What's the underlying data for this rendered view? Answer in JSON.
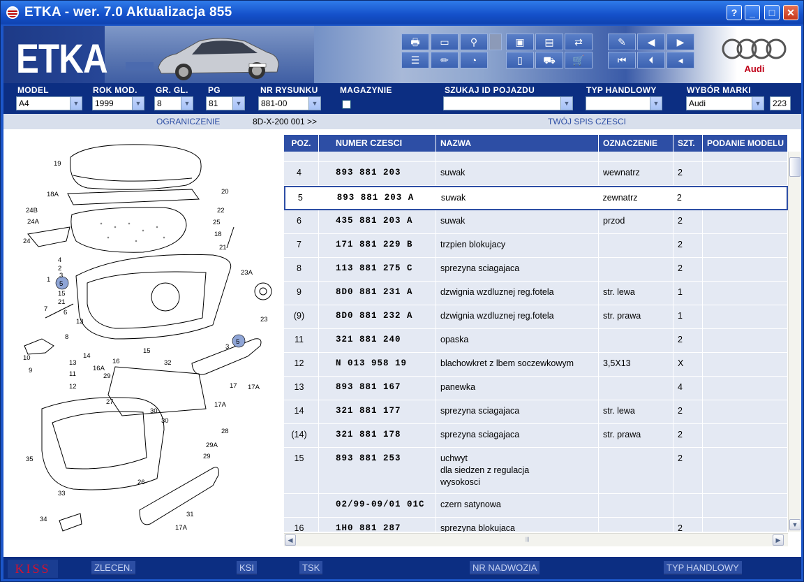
{
  "window": {
    "title": "ETKA - wer. 7.0 Aktualizacja 855",
    "buttons": [
      "?",
      "_",
      "□",
      "✕"
    ]
  },
  "header": {
    "logo": "ETKA",
    "brand": "Audi"
  },
  "filters": {
    "model": {
      "label": "MODEL",
      "value": "A4"
    },
    "rok_mod": {
      "label": "ROK MOD.",
      "value": "1999"
    },
    "gr_gl": {
      "label": "GR. GL.",
      "value": "8"
    },
    "pg": {
      "label": "PG",
      "value": "81"
    },
    "nr_rysunku": {
      "label": "NR RYSUNKU",
      "value": "881-00"
    },
    "magazynie": {
      "label": "MAGAZYNIE"
    },
    "szukaj": {
      "label": "SZUKAJ ID POJAZDU",
      "value": ""
    },
    "typ": {
      "label": "TYP HANDLOWY",
      "value": ""
    },
    "marka": {
      "label": "WYBÓR MARKI",
      "value": "Audi"
    },
    "count": "223"
  },
  "infobar": {
    "ograniczenie": "OGRANICZENIE",
    "range": "8D-X-200 001 >>",
    "spis": "TWÓJ SPIS CZESCI"
  },
  "table": {
    "headers": [
      "POZ.",
      "NUMER CZESCI",
      "NAZWA",
      "OZNACZENIE",
      "SZT.",
      "PODANIE MODELU"
    ],
    "rows": [
      {
        "poz": "",
        "nr": "",
        "nazwa": "",
        "ozn": "",
        "szt": ""
      },
      {
        "poz": "4",
        "nr": "893 881 203",
        "nazwa": "suwak",
        "ozn": "wewnatrz",
        "szt": "2"
      },
      {
        "poz": "5",
        "nr": "893 881 203 A",
        "nazwa": "suwak",
        "ozn": "zewnatrz",
        "szt": "2"
      },
      {
        "poz": "6",
        "nr": "435 881 203 A",
        "nazwa": "suwak",
        "ozn": "przod",
        "szt": "2"
      },
      {
        "poz": "7",
        "nr": "171 881 229 B",
        "nazwa": "trzpien blokujacy",
        "ozn": "",
        "szt": "2"
      },
      {
        "poz": "8",
        "nr": "113 881 275 C",
        "nazwa": "sprezyna sciagajaca",
        "ozn": "",
        "szt": "2"
      },
      {
        "poz": "9",
        "nr": "8D0 881 231 A",
        "nazwa": "dzwignia wzdluznej reg.fotela",
        "ozn": "str. lewa",
        "szt": "1"
      },
      {
        "poz": "(9)",
        "nr": "8D0 881 232 A",
        "nazwa": "dzwignia wzdluznej reg.fotela",
        "ozn": "str. prawa",
        "szt": "1"
      },
      {
        "poz": "11",
        "nr": "321 881 240",
        "nazwa": "opaska",
        "ozn": "",
        "szt": "2"
      },
      {
        "poz": "12",
        "nr": "N   013 958 19",
        "nazwa": "blachowkret z lbem soczewkowym",
        "ozn": "3,5X13",
        "szt": "X"
      },
      {
        "poz": "13",
        "nr": "893 881 167",
        "nazwa": "panewka",
        "ozn": "",
        "szt": "4"
      },
      {
        "poz": "14",
        "nr": "321 881 177",
        "nazwa": "sprezyna sciagajaca",
        "ozn": "str. lewa",
        "szt": "2"
      },
      {
        "poz": "(14)",
        "nr": "321 881 178",
        "nazwa": "sprezyna sciagajaca",
        "ozn": "str. prawa",
        "szt": "2"
      },
      {
        "poz": "15",
        "nr": "893 881 253",
        "nazwa": "uchwyt\ndla siedzen z regulacja\nwysokosci",
        "ozn": "",
        "szt": "2"
      },
      {
        "poz": "",
        "nr": "02/99-09/01 01C",
        "nazwa": "czern satynowa",
        "ozn": "",
        "szt": ""
      },
      {
        "poz": "16",
        "nr": "1H0 881 287",
        "nazwa": "sprezyna blokujaca",
        "ozn": "",
        "szt": "2"
      }
    ]
  },
  "diagram_labels": [
    "19",
    "20",
    "18A",
    "22",
    "24B",
    "25",
    "24A",
    "18",
    "24",
    "21",
    "4",
    "2",
    "1",
    "5",
    "15",
    "21",
    "23A",
    "3",
    "7",
    "6",
    "13",
    "8",
    "10",
    "9",
    "14",
    "13",
    "16A",
    "16",
    "11",
    "12",
    "29",
    "32",
    "27",
    "5",
    "3",
    "23",
    "15",
    "17",
    "17A",
    "17A",
    "30",
    "30",
    "28",
    "29A",
    "35",
    "29",
    "26",
    "33",
    "34",
    "31",
    "17A"
  ],
  "footer": {
    "kiss": "KISS",
    "zlecen": "ZLECEN.",
    "ksi": "KSI",
    "tsk": "TSK",
    "nadwozia": "NR NADWOZIA",
    "typ": "TYP HANDLOWY"
  }
}
